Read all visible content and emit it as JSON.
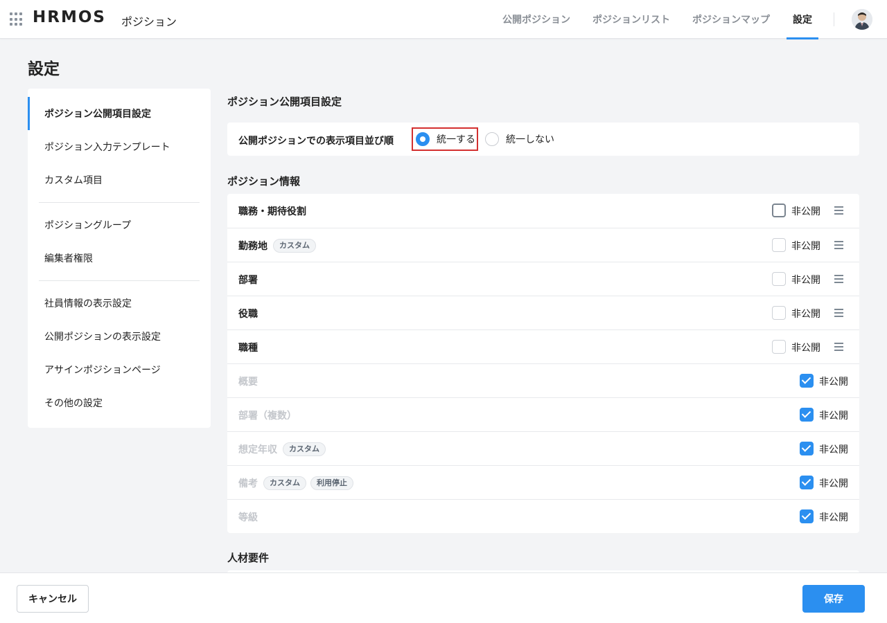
{
  "header": {
    "logo": "HRMOS",
    "product": "ポジション",
    "nav": [
      "公開ポジション",
      "ポジションリスト",
      "ポジションマップ",
      "設定"
    ],
    "active_nav": "設定"
  },
  "page_title": "設定",
  "sidebar": {
    "items": [
      "ポジション公開項目設定",
      "ポジション入力テンプレート",
      "カスタム項目",
      "ポジショングループ",
      "編集者権限",
      "社員情報の表示設定",
      "公開ポジションの表示設定",
      "アサインポジションページ",
      "その他の設定"
    ],
    "active": "ポジション公開項目設定"
  },
  "main": {
    "section_title": "ポジション公開項目設定",
    "display_order": {
      "label": "公開ポジションでの表示項目並び順",
      "options": [
        "統一する",
        "統一しない"
      ],
      "selected": "統一する"
    },
    "position_info": {
      "title": "ポジション情報",
      "hide_label": "非公開",
      "rows": [
        {
          "label": "職務・期待役割",
          "tags": [],
          "hidden": false,
          "disabled": false
        },
        {
          "label": "勤務地",
          "tags": [
            "カスタム"
          ],
          "hidden": false,
          "disabled": false
        },
        {
          "label": "部署",
          "tags": [],
          "hidden": false,
          "disabled": false
        },
        {
          "label": "役職",
          "tags": [],
          "hidden": false,
          "disabled": false
        },
        {
          "label": "職種",
          "tags": [],
          "hidden": false,
          "disabled": false
        },
        {
          "label": "概要",
          "tags": [],
          "hidden": true,
          "disabled": true
        },
        {
          "label": "部署（複数）",
          "tags": [],
          "hidden": true,
          "disabled": true
        },
        {
          "label": "想定年収",
          "tags": [
            "カスタム"
          ],
          "hidden": true,
          "disabled": true
        },
        {
          "label": "備考",
          "tags": [
            "カスタム",
            "利用停止"
          ],
          "hidden": true,
          "disabled": true
        },
        {
          "label": "等級",
          "tags": [],
          "hidden": true,
          "disabled": true
        }
      ]
    },
    "talent_requirements": {
      "title": "人材要件"
    }
  },
  "footer": {
    "cancel_label": "キャンセル",
    "save_label": "保存"
  },
  "colors": {
    "accent": "#2b8ff0",
    "highlight": "#d32f2f",
    "background": "#f3f4f6"
  }
}
